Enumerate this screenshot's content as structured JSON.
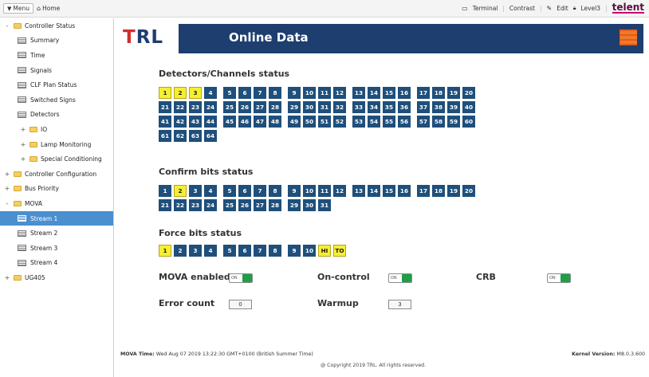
{
  "topbar": {
    "menu": "Menu",
    "home": "Home",
    "terminal": "Terminal",
    "contrast": "Contrast",
    "edit": "Edit",
    "level": "Level3",
    "brand": "telent"
  },
  "sidebar": {
    "items": [
      {
        "label": "Controller Status",
        "type": "folder",
        "toggle": "-",
        "indent": 0
      },
      {
        "label": "Summary",
        "type": "page",
        "indent": 1
      },
      {
        "label": "Time",
        "type": "page",
        "indent": 1
      },
      {
        "label": "Signals",
        "type": "page",
        "indent": 1
      },
      {
        "label": "CLF Plan Status",
        "type": "page",
        "indent": 1
      },
      {
        "label": "Switched Signs",
        "type": "page",
        "indent": 1
      },
      {
        "label": "Detectors",
        "type": "page",
        "indent": 1
      },
      {
        "label": "IO",
        "type": "folder",
        "toggle": "+",
        "indent": 1
      },
      {
        "label": "Lamp Monitoring",
        "type": "folder",
        "toggle": "+",
        "indent": 1
      },
      {
        "label": "Special Conditioning",
        "type": "folder",
        "toggle": "+",
        "indent": 1
      },
      {
        "label": "Controller Configuration",
        "type": "folder",
        "toggle": "+",
        "indent": 0
      },
      {
        "label": "Bus Priority",
        "type": "folder",
        "toggle": "+",
        "indent": 0
      },
      {
        "label": "MOVA",
        "type": "folder",
        "toggle": "-",
        "indent": 0
      },
      {
        "label": "Stream 1",
        "type": "page",
        "indent": 1,
        "active": true
      },
      {
        "label": "Stream 2",
        "type": "page",
        "indent": 1
      },
      {
        "label": "Stream 3",
        "type": "page",
        "indent": 1
      },
      {
        "label": "Stream 4",
        "type": "page",
        "indent": 1
      },
      {
        "label": "UG405",
        "type": "folder",
        "toggle": "+",
        "indent": 0
      }
    ]
  },
  "header": {
    "title": "Online Data",
    "logo": "TRL"
  },
  "detectors": {
    "title": "Detectors/Channels status",
    "rows": [
      [
        [
          "1",
          "2",
          "3",
          "4"
        ],
        [
          "5",
          "6",
          "7",
          "8"
        ],
        [
          "9",
          "10",
          "11",
          "12"
        ],
        [
          "13",
          "14",
          "15",
          "16"
        ],
        [
          "17",
          "18",
          "19",
          "20"
        ]
      ],
      [
        [
          "21",
          "22",
          "23",
          "24"
        ],
        [
          "25",
          "26",
          "27",
          "28"
        ],
        [
          "29",
          "30",
          "31",
          "32"
        ],
        [
          "33",
          "34",
          "35",
          "36"
        ],
        [
          "37",
          "38",
          "39",
          "40"
        ]
      ],
      [
        [
          "41",
          "42",
          "43",
          "44"
        ],
        [
          "45",
          "46",
          "47",
          "48"
        ],
        [
          "49",
          "50",
          "51",
          "52"
        ],
        [
          "53",
          "54",
          "55",
          "56"
        ],
        [
          "57",
          "58",
          "59",
          "60"
        ]
      ],
      [
        [
          "61",
          "62",
          "63",
          "64"
        ]
      ]
    ],
    "on": [
      "1",
      "2",
      "3"
    ]
  },
  "confirm": {
    "title": "Confirm bits status",
    "rows": [
      [
        [
          "1",
          "2",
          "3",
          "4"
        ],
        [
          "5",
          "6",
          "7",
          "8"
        ],
        [
          "9",
          "10",
          "11",
          "12"
        ],
        [
          "13",
          "14",
          "15",
          "16"
        ],
        [
          "17",
          "18",
          "19",
          "20"
        ]
      ],
      [
        [
          "21",
          "22",
          "23",
          "24"
        ],
        [
          "25",
          "26",
          "27",
          "28"
        ],
        [
          "29",
          "30",
          "31"
        ]
      ]
    ],
    "on": [
      "2"
    ]
  },
  "force": {
    "title": "Force bits status",
    "rows": [
      [
        [
          "1",
          "2",
          "3",
          "4"
        ],
        [
          "5",
          "6",
          "7",
          "8"
        ],
        [
          "9",
          "10",
          "HI",
          "TO"
        ]
      ]
    ],
    "on": [
      "1",
      "HI",
      "TO"
    ]
  },
  "status": {
    "mova_enabled_label": "MOVA enabled",
    "mova_enabled_state": "ON",
    "on_control_label": "On-control",
    "on_control_state": "ON",
    "crb_label": "CRB",
    "crb_state": "ON",
    "error_count_label": "Error count",
    "error_count_value": "0",
    "warmup_label": "Warmup",
    "warmup_value": "3"
  },
  "footer": {
    "mova_time_label": "MOVA Time:",
    "mova_time_value": "Wed Aug 07 2019 13:22:30 GMT+0100 (British Summer Time)",
    "kernel_label": "Kernel Version:",
    "kernel_value": "M8.0.3.600",
    "copyright": "@ Copyright 2019 TRL. All rights reserved."
  },
  "colors": {
    "header_blue": "#1d3e6f",
    "cell_blue": "#1f4f7b",
    "cell_on": "#f6ef31",
    "toggle_green": "#1e9f45",
    "active_row": "#4a8fd0"
  }
}
